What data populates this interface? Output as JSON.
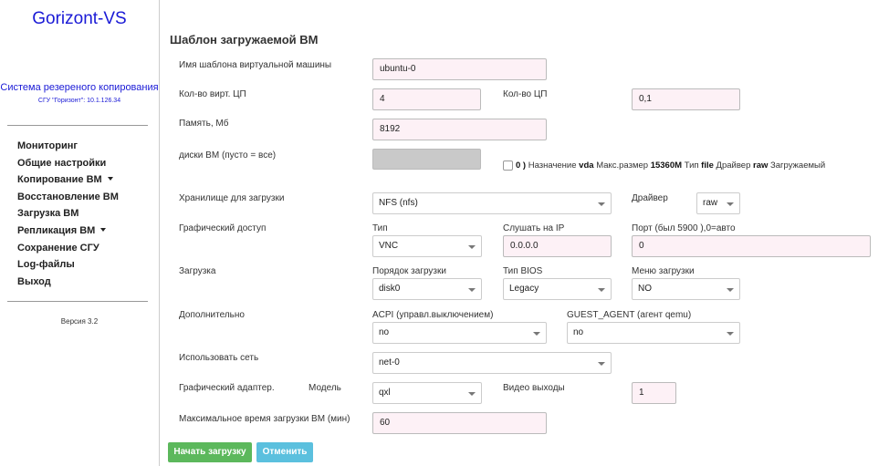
{
  "sidebar": {
    "brand": "Gorizont-VS",
    "subtitle": "Система резереного копирования",
    "host": "СГУ \"Горизонт\": 10.1.126.34",
    "nav": [
      {
        "label": "Мониторинг",
        "caret": false
      },
      {
        "label": "Общие настройки",
        "caret": false
      },
      {
        "label": "Копирование ВМ",
        "caret": true
      },
      {
        "label": "Восстановление ВМ",
        "caret": false
      },
      {
        "label": "Загрузка ВМ",
        "caret": false
      },
      {
        "label": "Репликация ВМ",
        "caret": true
      },
      {
        "label": "Сохранение СГУ",
        "caret": false
      },
      {
        "label": "Log-файлы",
        "caret": false
      },
      {
        "label": "Выход",
        "caret": false
      }
    ],
    "version": "Версия 3.2"
  },
  "form": {
    "title": "Шаблон загружаемой ВМ",
    "template_name_label": "Имя шаблона виртуальной машины",
    "template_name_value": "ubuntu-0",
    "vcpu_label": "Кол-во вирт. ЦП",
    "vcpu_value": "4",
    "cpu_label": "Кол-во ЦП",
    "cpu_value": "0,1",
    "memory_label": "Память, Мб",
    "memory_value": "8192",
    "disks_label": "диски ВМ (пусто = все)",
    "disk": {
      "index": "0 )",
      "dest_label": "Назначение",
      "dest_value": "vda",
      "size_label": "Макс.размер",
      "size_value": "15360M",
      "type_label": "Тип",
      "type_value": "file",
      "driver_label": "Драйвер",
      "driver_value": "raw",
      "bootable_label": "Загружаемый"
    },
    "storage_label": "Хранилище для загрузки",
    "storage_value": "NFS (nfs)",
    "driver_label": "Драйвер",
    "driver_value": "raw",
    "graphics_label": "Графический доступ",
    "graphics_type_label": "Тип",
    "graphics_type_value": "VNC",
    "listen_label": "Слушать на IP",
    "listen_value": "0.0.0.0",
    "port_label": "Порт (был 5900 ),0=авто",
    "port_value": "0",
    "boot_label": "Загрузка",
    "boot_order_label": "Порядок загрузки",
    "boot_order_value": "disk0",
    "bios_label": "Тип BIOS",
    "bios_value": "Legacy",
    "boot_menu_label": "Меню загрузки",
    "boot_menu_value": "NO",
    "extra_label": "Дополнительно",
    "acpi_label": "ACPI (управл.выключением)",
    "acpi_value": "no",
    "guest_agent_label": "GUEST_AGENT (агент qemu)",
    "guest_agent_value": "no",
    "network_label": "Использовать сеть",
    "network_value": "net-0",
    "adapter_label": "Графический адаптер.",
    "model_label": "Модель",
    "model_value": "qxl",
    "video_outputs_label": "Видео выходы",
    "video_outputs_value": "1",
    "max_boot_time_label": "Максимальное время загрузки ВМ (мин)",
    "max_boot_time_value": "60",
    "start_button": "Начать загрузку",
    "cancel_button": "Отменить"
  },
  "colors": {
    "brand": "#1a1ad6",
    "input_bg": "#fdf1f6",
    "start_button": "#5cb85c",
    "cancel_button": "#5bc0de"
  }
}
